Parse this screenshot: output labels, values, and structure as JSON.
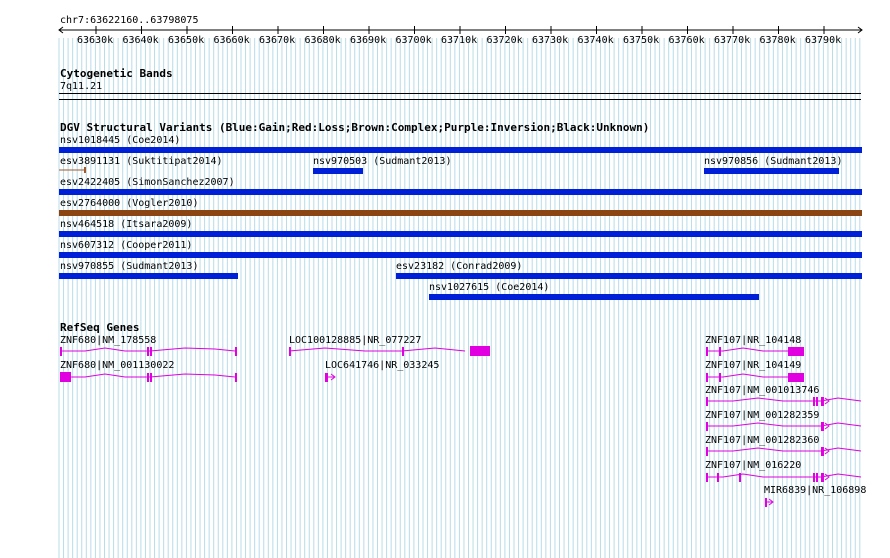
{
  "ruler": {
    "range_label": "chr7:63622160..63798075",
    "ticks": [
      "63630k",
      "63640k",
      "63650k",
      "63660k",
      "63670k",
      "63680k",
      "63690k",
      "63700k",
      "63710k",
      "63720k",
      "63730k",
      "63740k",
      "63750k",
      "63760k",
      "63770k",
      "63780k",
      "63790k"
    ]
  },
  "cytoband": {
    "title": "Cytogenetic Bands",
    "band": "7q11.21"
  },
  "dgv": {
    "title": "DGV Structural Variants (Blue:Gain;Red:Loss;Brown:Complex;Purple:Inversion;Black:Unknown)",
    "colors": {
      "gain": "#0020d8",
      "complex": "#8b4513",
      "tick": "#a05a2c"
    },
    "variants": {
      "v1": "nsv1018445 (Coe2014)",
      "v2": "esv3891131 (Suktitipat2014)",
      "v3": "nsv970503 (Sudmant2013)",
      "v4": "nsv970856 (Sudmant2013)",
      "v5": "esv2422405 (SimonSanchez2007)",
      "v6": "esv2764000 (Vogler2010)",
      "v7": "nsv464518 (Itsara2009)",
      "v8": "nsv607312 (Cooper2011)",
      "v9": "nsv970855 (Sudmant2013)",
      "v10": "esv23182 (Conrad2009)",
      "v11": "nsv1027615 (Coe2014)"
    }
  },
  "refseq": {
    "title": "RefSeq Genes",
    "color": "#e000e0",
    "genes": {
      "g1": "ZNF680|NM_178558",
      "g2": "ZNF680|NM_001130022",
      "g3": "LOC100128885|NR_077227",
      "g4": "LOC641746|NR_033245",
      "g5": "ZNF107|NR_104148",
      "g6": "ZNF107|NR_104149",
      "g7": "ZNF107|NM_001013746",
      "g8": "ZNF107|NM_001282359",
      "g9": "ZNF107|NM_001282360",
      "g10": "ZNF107|NM_016220",
      "g11": "MIR6839|NR_106898"
    }
  }
}
